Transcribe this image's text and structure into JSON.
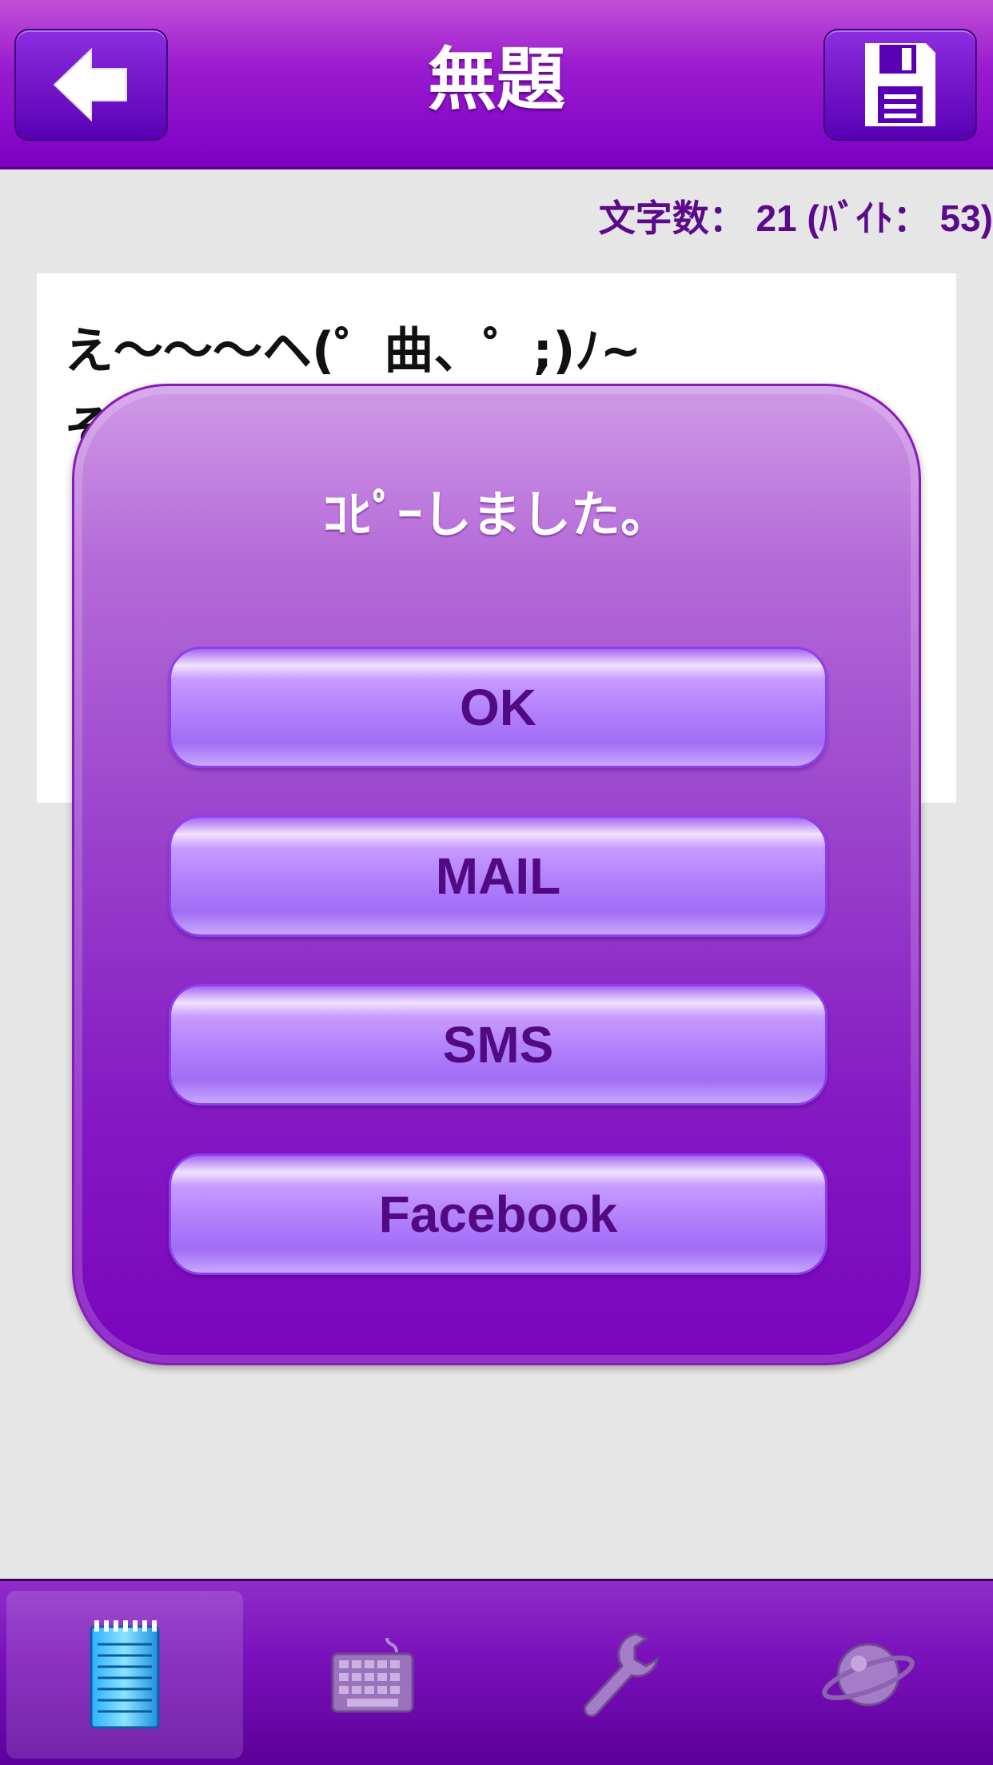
{
  "header": {
    "title": "無題",
    "back_icon": "back-arrow-icon",
    "save_icon": "floppy-disk-icon"
  },
  "counter": {
    "text": "文字数： 21 (ﾊﾞｲﾄ： 53)"
  },
  "editor": {
    "line1": "え〜〜〜ヘ(゜曲、゜;)ﾉ~",
    "line2": "そ"
  },
  "dialog": {
    "message": "ｺﾋﾟｰしました。",
    "buttons": {
      "ok": "OK",
      "mail": "MAIL",
      "sms": "SMS",
      "facebook": "Facebook"
    }
  },
  "tabs": [
    {
      "icon": "notepad-icon",
      "active": true
    },
    {
      "icon": "keyboard-icon",
      "active": false
    },
    {
      "icon": "wrench-icon",
      "active": false
    },
    {
      "icon": "planet-icon",
      "active": false
    }
  ],
  "colors": {
    "accent": "#7d00c4",
    "dialog_text": "#520a82",
    "counter_text": "#5c0a8c"
  }
}
